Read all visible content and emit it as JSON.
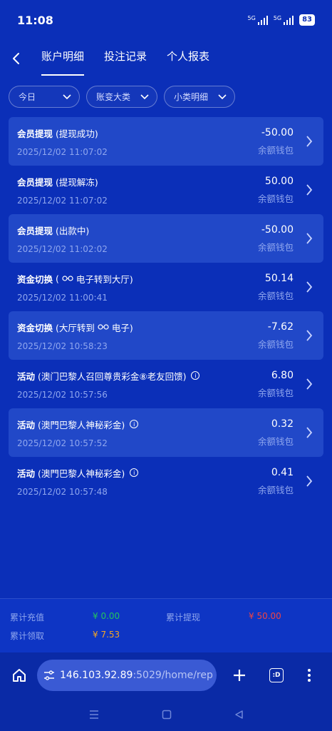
{
  "status": {
    "time": "11:08",
    "sig1": "5G",
    "sig2": "5G",
    "battery": "83"
  },
  "nav": {
    "tabs": [
      {
        "label": "账户明细"
      },
      {
        "label": "投注记录"
      },
      {
        "label": "个人报表"
      }
    ]
  },
  "filters": [
    {
      "label": "今日"
    },
    {
      "label": "账变大类"
    },
    {
      "label": "小类明细"
    }
  ],
  "rows": [
    {
      "title": "会员提现",
      "detail": "(提现成功)",
      "time": "2025/12/02 11:07:02",
      "amount": "-50.00",
      "wallet": "余额钱包"
    },
    {
      "title": "会员提现",
      "detail": "(提现解冻)",
      "time": "2025/12/02 11:07:02",
      "amount": "50.00",
      "wallet": "余额钱包"
    },
    {
      "title": "会员提现",
      "detail": "(出款中)",
      "time": "2025/12/02 11:02:02",
      "amount": "-50.00",
      "wallet": "余额钱包"
    },
    {
      "title": "资金切换",
      "detail_pre": "(",
      "detail_post": "电子转到大厅)",
      "time": "2025/12/02 11:00:41",
      "amount": "50.14",
      "wallet": "余额钱包"
    },
    {
      "title": "资金切换",
      "detail_pre": "(大厅转到",
      "detail_post": "电子)",
      "time": "2025/12/02 10:58:23",
      "amount": "-7.62",
      "wallet": "余额钱包"
    },
    {
      "title": "活动",
      "detail": "(澳门巴黎人召回尊贵彩金⑧老友回馈)",
      "time": "2025/12/02 10:57:56",
      "amount": "6.80",
      "wallet": "余额钱包"
    },
    {
      "title": "活动",
      "detail": "(澳門巴黎人神秘彩金)",
      "time": "2025/12/02 10:57:52",
      "amount": "0.32",
      "wallet": "余额钱包"
    },
    {
      "title": "活动",
      "detail": "(澳門巴黎人神秘彩金)",
      "time": "2025/12/02 10:57:48",
      "amount": "0.41",
      "wallet": "余额钱包"
    }
  ],
  "summary": {
    "deposit_label": "累计充值",
    "deposit_value": "¥ 0.00",
    "withdraw_label": "累计提现",
    "withdraw_value": "¥ 50.00",
    "claim_label": "累计领取",
    "claim_value": "¥ 7.53"
  },
  "browser": {
    "url_host": "146.103.92.89",
    "url_rest": ":5029/home/rep",
    "tab_label": ":D"
  },
  "colors": {
    "background": "#0b2fb8",
    "row_highlight": "#2148c8",
    "green": "#22c55e",
    "red": "#ef4444",
    "orange": "#f5a524"
  }
}
